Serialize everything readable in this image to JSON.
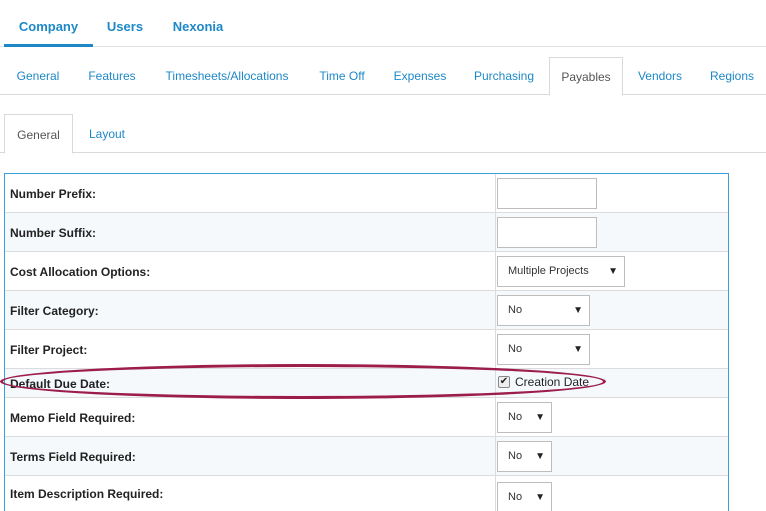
{
  "top_nav": {
    "tabs": [
      {
        "label": "Company",
        "active": true
      },
      {
        "label": "Users",
        "active": false
      },
      {
        "label": "Nexonia",
        "active": false
      }
    ]
  },
  "settings_tabs": [
    {
      "label": "General",
      "active": false
    },
    {
      "label": "Features",
      "active": false
    },
    {
      "label": "Timesheets/Allocations",
      "active": false
    },
    {
      "label": "Time Off",
      "active": false
    },
    {
      "label": "Expenses",
      "active": false
    },
    {
      "label": "Purchasing",
      "active": false
    },
    {
      "label": "Payables",
      "active": true
    },
    {
      "label": "Vendors",
      "active": false
    },
    {
      "label": "Regions",
      "active": false
    }
  ],
  "sub_tabs": [
    {
      "label": "General",
      "active": true
    },
    {
      "label": "Layout",
      "active": false
    }
  ],
  "form": {
    "number_prefix": {
      "label": "Number Prefix:",
      "value": ""
    },
    "number_suffix": {
      "label": "Number Suffix:",
      "value": ""
    },
    "cost_allocation": {
      "label": "Cost Allocation Options:",
      "value": "Multiple Projects"
    },
    "filter_category": {
      "label": "Filter Category:",
      "value": "No"
    },
    "filter_project": {
      "label": "Filter Project:",
      "value": "No"
    },
    "default_due_date": {
      "label": "Default Due Date:",
      "checkbox_label": "Creation Date",
      "checked": true
    },
    "memo_required": {
      "label": "Memo Field Required:",
      "value": "No"
    },
    "terms_required": {
      "label": "Terms Field Required:",
      "value": "No"
    },
    "item_description_required": {
      "label": "Item Description Required:",
      "value": "No"
    }
  },
  "colors": {
    "accent": "#1e88c7",
    "table_border": "#3b9fd9",
    "highlight": "#9c1c4a"
  }
}
